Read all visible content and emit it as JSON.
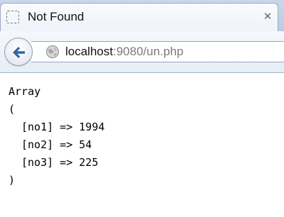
{
  "tab": {
    "title": "Not Found",
    "close_glyph": "✕",
    "favicon": "blank-page-icon"
  },
  "toolbar": {
    "back_icon": "back-arrow-icon",
    "site_icon": "globe-icon",
    "url_host": "localhost",
    "url_rest": ":9080/un.php"
  },
  "output": {
    "lines": [
      "Array",
      "(",
      "    [no1] => 1994",
      "    [no2] => 54",
      "    [no3] => 225",
      ")"
    ]
  },
  "colors": {
    "back_arrow": "#2f64a5",
    "tab_bg": "#f4f7fc",
    "text": "#000000"
  }
}
